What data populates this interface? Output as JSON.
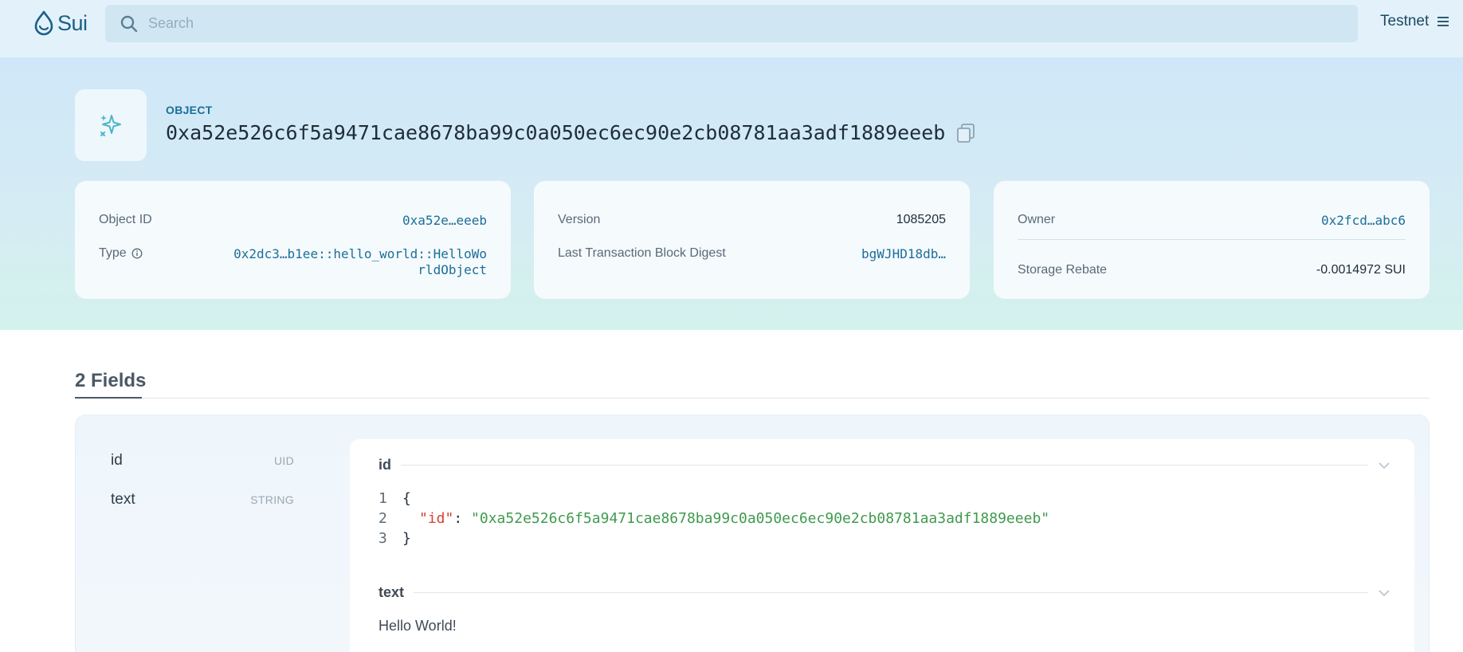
{
  "header": {
    "logo_text": "Sui",
    "search_placeholder": "Search",
    "network": "Testnet"
  },
  "object": {
    "label": "OBJECT",
    "id": "0xa52e526c6f5a9471cae8678ba99c0a050ec6ec90e2cb08781aa3adf1889eeeb"
  },
  "cards": {
    "object_id_label": "Object ID",
    "object_id_value": "0xa52e…eeeb",
    "type_label": "Type",
    "type_value": "0x2dc3…b1ee::hello_world::HelloWorldObject",
    "version_label": "Version",
    "version_value": "1085205",
    "digest_label": "Last Transaction Block Digest",
    "digest_value": "bgWJHD18db…",
    "owner_label": "Owner",
    "owner_value": "0x2fcd…abc6",
    "rebate_label": "Storage Rebate",
    "rebate_value": "-0.0014972 SUI"
  },
  "fields": {
    "title": "2 Fields",
    "list": [
      {
        "name": "id",
        "type": "UID"
      },
      {
        "name": "text",
        "type": "STRING"
      }
    ],
    "id_section": {
      "name": "id",
      "line_numbers": [
        "1",
        "2",
        "3"
      ],
      "open_brace": "{",
      "key": "\"id\"",
      "colon": ":",
      "value": "\"0xa52e526c6f5a9471cae8678ba99c0a050ec6ec90e2cb08781aa3adf1889eeeb\"",
      "close_brace": "}"
    },
    "text_section": {
      "name": "text",
      "value": "Hello World!"
    }
  },
  "colors": {
    "accent": "#1b6f98",
    "json_key": "#d6402f",
    "json_string": "#3f9a4d"
  }
}
